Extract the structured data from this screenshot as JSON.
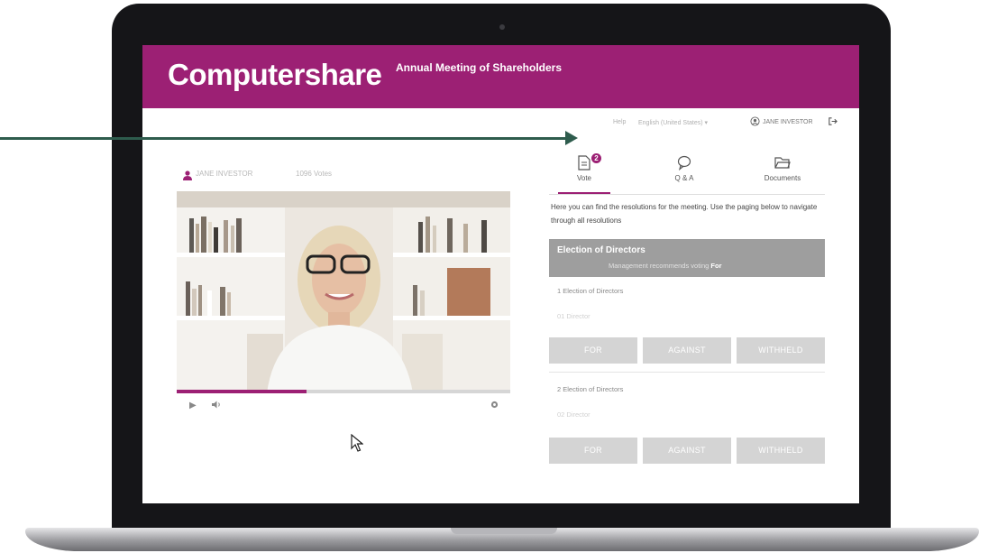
{
  "header": {
    "logo_text": "Computershare",
    "meeting_title": "Annual Meeting of Shareholders",
    "brand_color": "#9c2074"
  },
  "topbar": {
    "help_link": "Help",
    "language_select": "English (United States) ▾",
    "user_name": "JANE INVESTOR",
    "user_icon": "user-circle-icon",
    "logout_icon": "logout-icon"
  },
  "presenter": {
    "name": "JANE INVESTOR",
    "votes": "1096 Votes",
    "icon": "person-icon"
  },
  "video": {
    "progress": 0.39,
    "play_icon": "play-icon",
    "volume_icon": "volume-icon",
    "settings_icon": "settings-icon"
  },
  "tabs": [
    {
      "label": "Vote",
      "icon": "document-icon",
      "badge": "2",
      "active": true
    },
    {
      "label": "Q & A",
      "icon": "chat-icon"
    },
    {
      "label": "Documents",
      "icon": "folder-icon"
    }
  ],
  "vote_panel": {
    "intro": "Here you can find the resolutions for the meeting. Use the paging below to navigate through all resolutions",
    "section_title": "Election of Directors",
    "recommendation_prefix": "Management recommends voting",
    "recommendation_value": "For",
    "resolutions": [
      {
        "label": "1 Election of Directors",
        "director": "01 Director",
        "buttons": [
          "FOR",
          "AGAINST",
          "WITHHELD"
        ]
      },
      {
        "label": "2 Election of Directors",
        "director": "02 Director",
        "buttons": [
          "FOR",
          "AGAINST",
          "WITHHELD"
        ]
      }
    ]
  },
  "annotation": {
    "arrow_color": "#2e5c4d"
  }
}
